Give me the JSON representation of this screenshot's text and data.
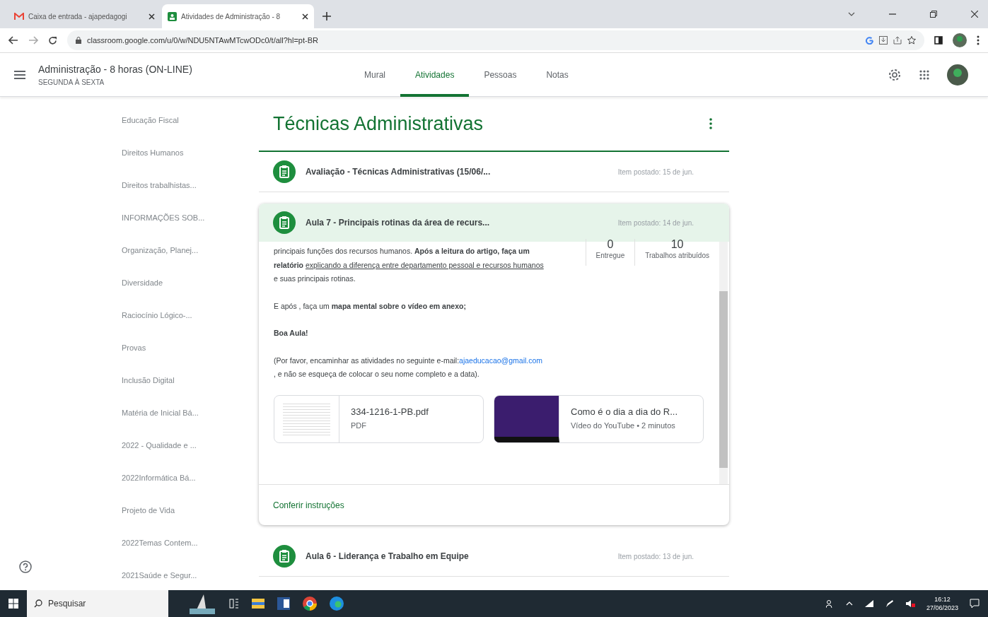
{
  "browser": {
    "tabs": [
      {
        "title": "Caixa de entrada - ajapedagogi",
        "selected": false,
        "kind": "mail"
      },
      {
        "title": "Atividades de Administração - 8",
        "selected": true,
        "kind": "classroom"
      }
    ],
    "url": "classroom.google.com/u/0/w/NDU5NTAwMTcwODc0/t/all?hl=pt-BR"
  },
  "class_header": {
    "title": "Administração - 8 horas (ON-LINE)",
    "subtitle": "SEGUNDA À SEXTA",
    "tabs": [
      {
        "label": "Mural",
        "selected": false
      },
      {
        "label": "Atividades",
        "selected": true
      },
      {
        "label": "Pessoas",
        "selected": false
      },
      {
        "label": "Notas",
        "selected": false
      }
    ]
  },
  "sidebar": {
    "items": [
      "Educação Fiscal",
      "Direitos Humanos",
      "Direitos trabalhistas...",
      "INFORMAÇÕES SOB...",
      "Organização, Planej...",
      "Diversidade",
      "Raciocínio Lógico-...",
      "Provas",
      "Inclusão Digital",
      "Matéria de Inicial Bá...",
      "2022 - Qualidade e ...",
      "2022Informática Bá...",
      "Projeto de Vida",
      "2022Temas Contem...",
      "2021Saúde e Segur..."
    ]
  },
  "topic": {
    "title": "Técnicas Administrativas",
    "items": [
      {
        "title": "Avaliação - Técnicas Administrativas (15/06/...",
        "posted": "Item postado: 15 de jun.",
        "expanded": false
      },
      {
        "title": "Aula 7 - Principais rotinas da área de recurs...",
        "posted": "Item postado: 14 de jun.",
        "expanded": true,
        "paragraphs": [
          [
            {
              "kind": "plain",
              "text": "principais funções dos recursos humanos. "
            },
            {
              "kind": "bold",
              "text": "Após a leitura do artigo, faça um relatório "
            },
            {
              "kind": "underline",
              "text": "explicando a diferença entre departamento pessoal e recursos humanos"
            },
            {
              "kind": "plain",
              "text": " e suas principais rotinas."
            }
          ],
          [
            {
              "kind": "plain",
              "text": "E após , faça um "
            },
            {
              "kind": "bold",
              "text": "mapa mental sobre o vídeo em anexo;"
            }
          ],
          [
            {
              "kind": "bold",
              "text": "Boa Aula!"
            }
          ],
          [
            {
              "kind": "plain",
              "text": "(Por favor, encaminhar as atividades no seguinte e-mail:"
            },
            {
              "kind": "link",
              "text": "ajaeducacao@gmail.com"
            },
            {
              "kind": "plain",
              "text": " , e não se esqueça de colocar o seu nome completo e a data)."
            }
          ]
        ],
        "stats": [
          {
            "value": "0",
            "label": "Entregue"
          },
          {
            "value": "10",
            "label": "Trabalhos atribuídos"
          }
        ],
        "attachments": [
          {
            "kind": "pdf",
            "title": "334-1216-1-PB.pdf",
            "meta": "PDF"
          },
          {
            "kind": "video",
            "title": "Como é o dia a dia do R...",
            "meta": "Vídeo do YouTube • 2 minutos"
          }
        ],
        "action": "Conferir instruções"
      },
      {
        "title": "Aula 6 - Liderança e Trabalho em Equipe",
        "posted": "Item postado: 13 de jun.",
        "expanded": false
      }
    ]
  },
  "taskbar": {
    "search": "Pesquisar",
    "time": "16:12",
    "date": "27/06/2023"
  }
}
